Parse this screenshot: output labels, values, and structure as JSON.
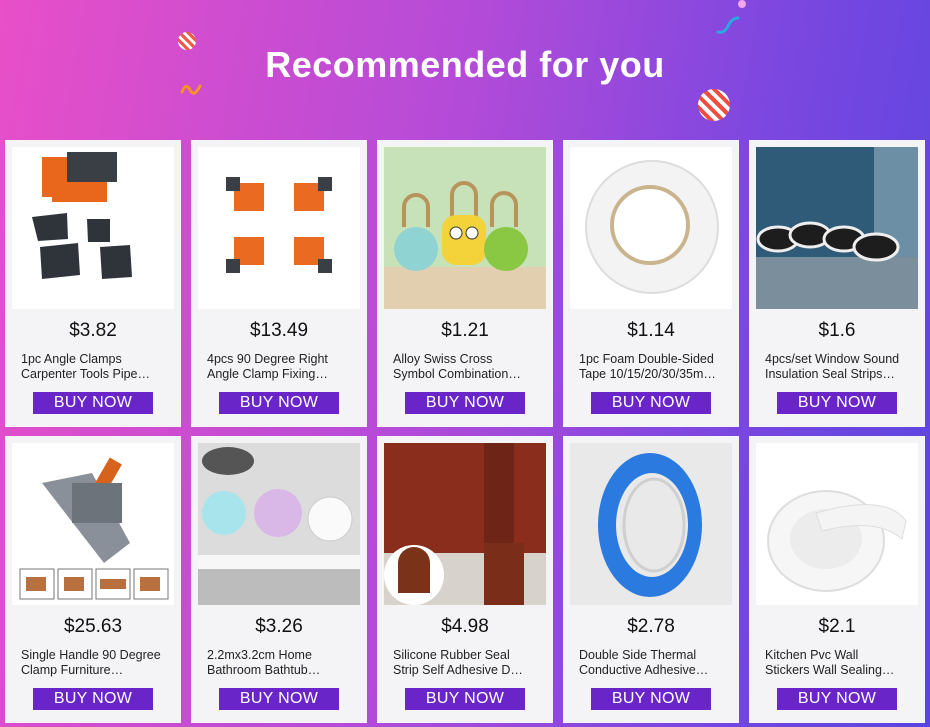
{
  "header": {
    "title": "Recommended for you"
  },
  "products": [
    {
      "price": "$3.82",
      "name_line1": "1pc Angle Clamps",
      "name_line2": "Carpenter Tools Pipe…",
      "button": "BUY NOW"
    },
    {
      "price": "$13.49",
      "name_line1": "4pcs 90 Degree Right",
      "name_line2": "Angle Clamp Fixing…",
      "button": "BUY NOW"
    },
    {
      "price": "$1.21",
      "name_line1": "Alloy Swiss Cross",
      "name_line2": "Symbol Combination…",
      "button": "BUY NOW"
    },
    {
      "price": "$1.14",
      "name_line1": "1pc Foam Double-Sided",
      "name_line2": "Tape 10/15/20/30/35m…",
      "button": "BUY NOW"
    },
    {
      "price": "$1.6",
      "name_line1": "4pcs/set Window Sound",
      "name_line2": "Insulation Seal Strips…",
      "button": "BUY NOW"
    },
    {
      "price": "$25.63",
      "name_line1": "Single Handle 90 Degree",
      "name_line2": "Clamp Furniture…",
      "button": "BUY NOW"
    },
    {
      "price": "$3.26",
      "name_line1": "2.2mx3.2cm Home",
      "name_line2": "Bathroom Bathtub…",
      "button": "BUY NOW"
    },
    {
      "price": "$4.98",
      "name_line1": "Silicone Rubber Seal",
      "name_line2": "Strip Self Adhesive D…",
      "button": "BUY NOW"
    },
    {
      "price": "$2.78",
      "name_line1": "Double Side Thermal",
      "name_line2": "Conductive Adhesive…",
      "button": "BUY NOW"
    },
    {
      "price": "$2.1",
      "name_line1": "Kitchen Pvc Wall",
      "name_line2": "Stickers Wall Sealing…",
      "button": "BUY NOW"
    }
  ],
  "colors": {
    "button": "#6a25c8",
    "card": "#f4f4f6"
  }
}
